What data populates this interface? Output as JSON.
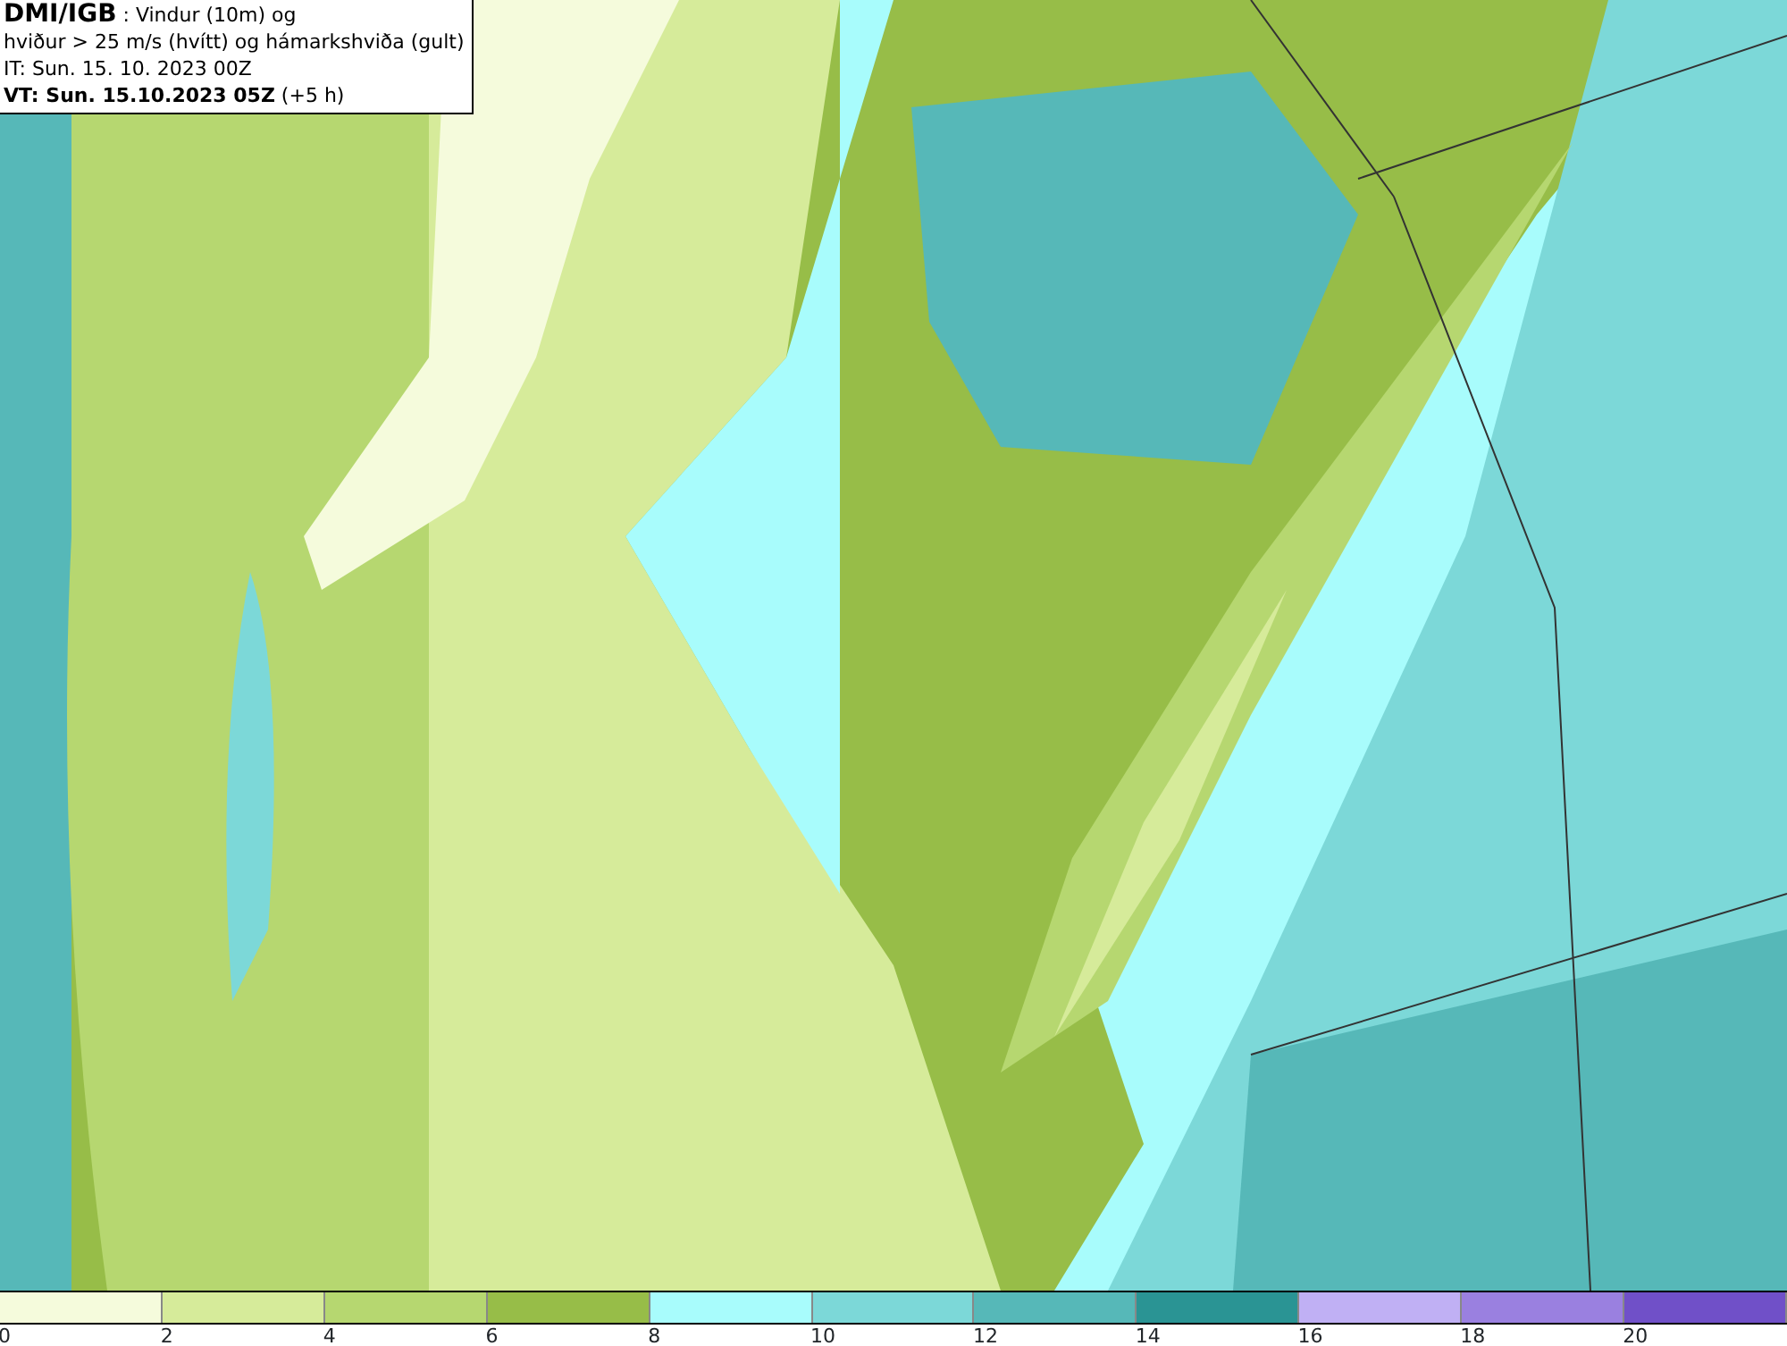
{
  "header": {
    "lines": [
      "**DMI/IGB** : Vindur (10m) og",
      "hviður > 25 m/s (hvítt) og hámarkshviða (gult)",
      "IT: Sun. 15. 10. 2023 00Z",
      "**VT: Sun. 15.10.2023 05Z** (+5 h)"
    ]
  },
  "legend": {
    "segments": [
      {
        "label": "0",
        "color": "#f5fbdc"
      },
      {
        "label": "2",
        "color": "#d6eb9a"
      },
      {
        "label": "4",
        "color": "#b6d770"
      },
      {
        "label": "6",
        "color": "#97bd48"
      },
      {
        "label": "8",
        "color": "#a8fcfc"
      },
      {
        "label": "10",
        "color": "#7cd8d8"
      },
      {
        "label": "12",
        "color": "#56b8b8"
      },
      {
        "label": "14",
        "color": "#2a9494"
      },
      {
        "label": "16",
        "color": "#c0b0f4"
      },
      {
        "label": "18",
        "color": "#9a80e0"
      },
      {
        "label": "20",
        "color": "#7050c8"
      }
    ]
  }
}
